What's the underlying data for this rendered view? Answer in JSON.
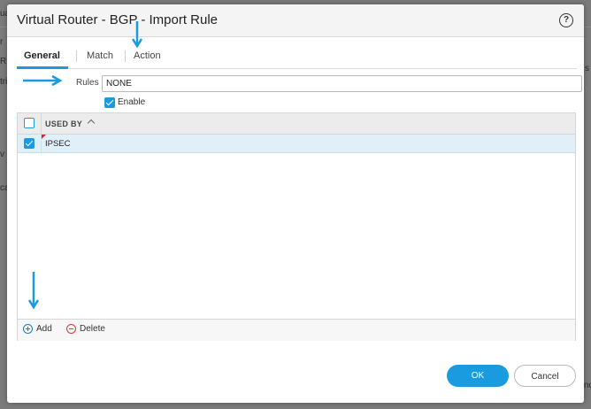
{
  "background": {
    "fragments": [
      "ua",
      "r",
      "R",
      "tri",
      "v",
      "ca",
      "s",
      "nc"
    ]
  },
  "dialog": {
    "title": "Virtual Router - BGP - Import Rule",
    "help_glyph": "?"
  },
  "tabs": [
    {
      "label": "General",
      "active": true
    },
    {
      "label": "Match",
      "active": false
    },
    {
      "label": "Action",
      "active": false
    }
  ],
  "rules": {
    "label": "Rules",
    "value": "NONE"
  },
  "enable": {
    "label": "Enable",
    "checked": true
  },
  "table": {
    "column_header": "USED BY",
    "rows": [
      {
        "value": "IPSEC",
        "checked": true
      }
    ]
  },
  "toolbar": {
    "add_label": "Add",
    "delete_label": "Delete"
  },
  "buttons": {
    "ok_label": "OK",
    "cancel_label": "Cancel"
  },
  "colors": {
    "accent": "#1a9be0",
    "annotation_arrow": "#1a9be0",
    "row_marker": "#d82626"
  }
}
